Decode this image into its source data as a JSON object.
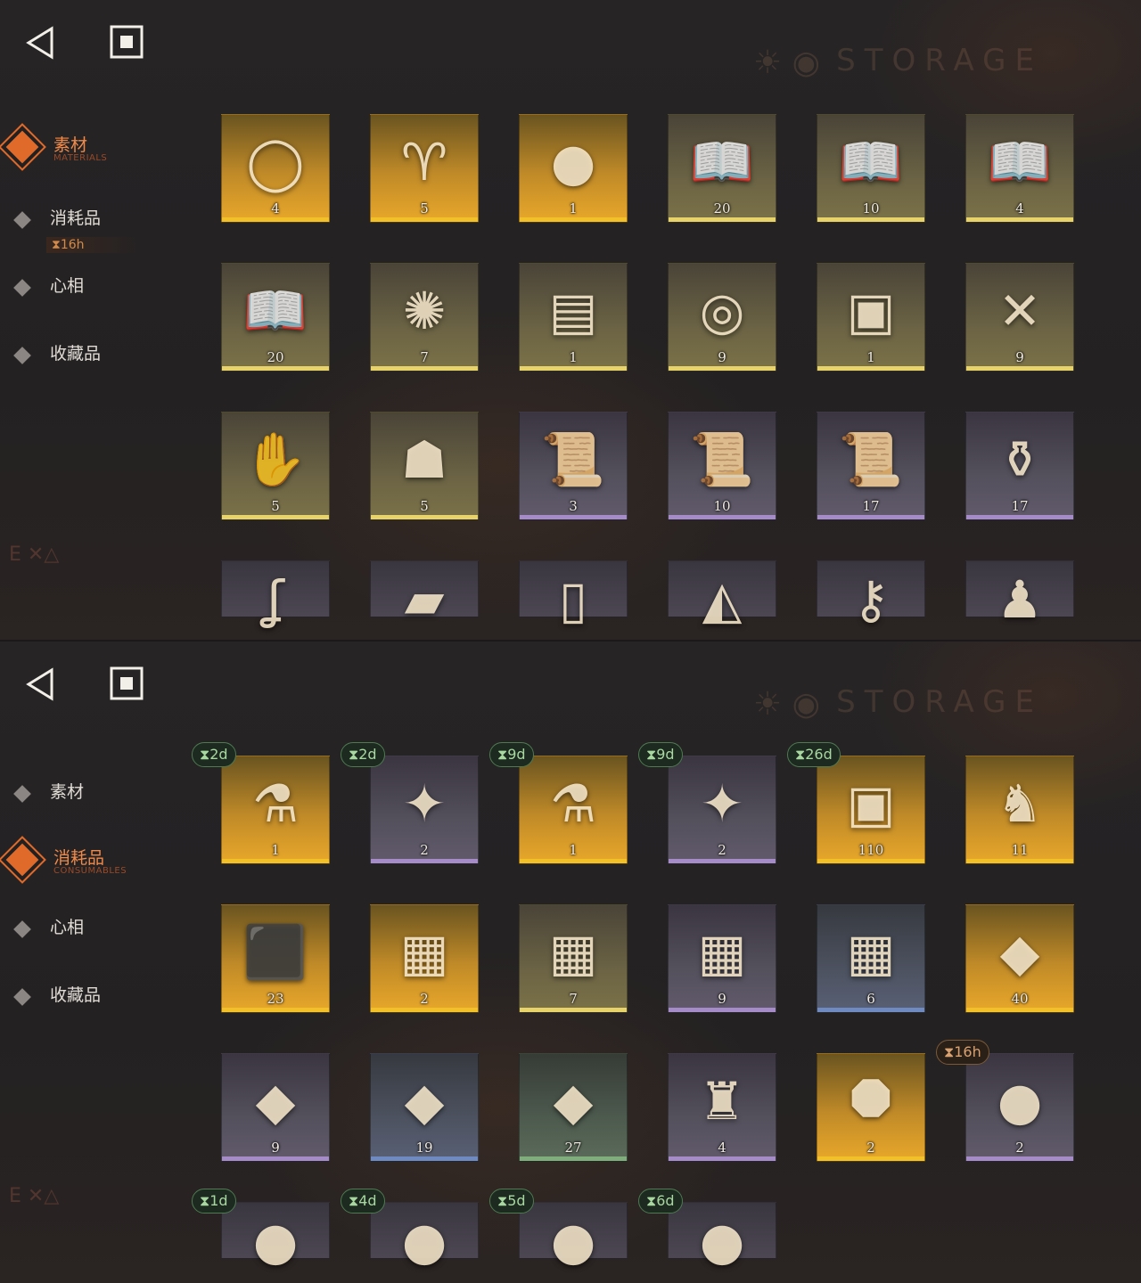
{
  "panels": [
    {
      "watermark": "STORAGE",
      "sidebar": {
        "items": [
          {
            "label": "素材",
            "sub": "MATERIALS",
            "active": true
          },
          {
            "label": "消耗品",
            "sub": "",
            "active": false
          },
          {
            "label": "心相",
            "sub": "",
            "active": false
          },
          {
            "label": "收藏品",
            "sub": "",
            "active": false
          }
        ],
        "timer": "⧗16h"
      },
      "items": [
        {
          "name": "ring",
          "icon": "◯",
          "count": "4",
          "rarity": "gold"
        },
        {
          "name": "yellow-ram",
          "icon": "♈",
          "count": "5",
          "rarity": "gold"
        },
        {
          "name": "apple-snake",
          "icon": "●",
          "count": "1",
          "rarity": "gold"
        },
        {
          "name": "book-red",
          "icon": "📖",
          "count": "20",
          "rarity": "olive"
        },
        {
          "name": "book-green",
          "icon": "📖",
          "count": "10",
          "rarity": "olive"
        },
        {
          "name": "book-blue",
          "icon": "📖",
          "count": "4",
          "rarity": "olive"
        },
        {
          "name": "book-gold",
          "icon": "📖",
          "count": "20",
          "rarity": "olive"
        },
        {
          "name": "astrolabe",
          "icon": "✺",
          "count": "7",
          "rarity": "olive"
        },
        {
          "name": "green-tablet",
          "icon": "▤",
          "count": "1",
          "rarity": "olive"
        },
        {
          "name": "metal-coin",
          "icon": "◎",
          "count": "9",
          "rarity": "olive"
        },
        {
          "name": "dark-book",
          "icon": "▣",
          "count": "1",
          "rarity": "olive"
        },
        {
          "name": "bullets",
          "icon": "✕",
          "count": "9",
          "rarity": "olive"
        },
        {
          "name": "hand-box",
          "icon": "✋",
          "count": "5",
          "rarity": "olive"
        },
        {
          "name": "ghost",
          "icon": "☗",
          "count": "5",
          "rarity": "olive"
        },
        {
          "name": "scroll-green",
          "icon": "📜",
          "count": "3",
          "rarity": "purple"
        },
        {
          "name": "scroll-blue",
          "icon": "📜",
          "count": "10",
          "rarity": "purple"
        },
        {
          "name": "scroll-gold",
          "icon": "📜",
          "count": "17",
          "rarity": "purple"
        },
        {
          "name": "amulet",
          "icon": "⚱",
          "count": "17",
          "rarity": "purple"
        },
        {
          "name": "hook",
          "icon": "ʆ",
          "count": "",
          "rarity": "plain"
        },
        {
          "name": "stone-tablet",
          "icon": "▰",
          "count": "",
          "rarity": "plain"
        },
        {
          "name": "frame",
          "icon": "▯",
          "count": "",
          "rarity": "plain"
        },
        {
          "name": "mask",
          "icon": "◭",
          "count": "",
          "rarity": "plain"
        },
        {
          "name": "dragonfly-key",
          "icon": "⚷",
          "count": "",
          "rarity": "plain"
        },
        {
          "name": "bird-figurine",
          "icon": "♟",
          "count": "",
          "rarity": "plain"
        }
      ]
    },
    {
      "watermark": "STORAGE",
      "sidebar": {
        "items": [
          {
            "label": "素材",
            "sub": "",
            "active": false
          },
          {
            "label": "消耗品",
            "sub": "CONSUMABLES",
            "active": true
          },
          {
            "label": "心相",
            "sub": "",
            "active": false
          },
          {
            "label": "收藏品",
            "sub": "",
            "active": false
          }
        ]
      },
      "items": [
        {
          "name": "candy-jar",
          "icon": "⚗",
          "count": "1",
          "rarity": "gold",
          "timer": "⧗2d",
          "timer_color": "green"
        },
        {
          "name": "lollipops",
          "icon": "✦",
          "count": "2",
          "rarity": "purple",
          "timer": "⧗2d",
          "timer_color": "green"
        },
        {
          "name": "candy-jar",
          "icon": "⚗",
          "count": "1",
          "rarity": "gold",
          "timer": "⧗9d",
          "timer_color": "green"
        },
        {
          "name": "lollipops",
          "icon": "✦",
          "count": "2",
          "rarity": "purple",
          "timer": "⧗9d",
          "timer_color": "green"
        },
        {
          "name": "red-book",
          "icon": "▣",
          "count": "110",
          "rarity": "gold",
          "timer": "⧗26d",
          "timer_color": "green"
        },
        {
          "name": "rabbit-box",
          "icon": "♞",
          "count": "11",
          "rarity": "gold",
          "timer": "",
          "timer_color": ""
        },
        {
          "name": "rune-box",
          "icon": "⬛",
          "count": "23",
          "rarity": "gold",
          "timer": "",
          "timer_color": ""
        },
        {
          "name": "crate-gold",
          "icon": "▦",
          "count": "2",
          "rarity": "gold",
          "timer": "",
          "timer_color": ""
        },
        {
          "name": "crate-olive",
          "icon": "▦",
          "count": "7",
          "rarity": "olive",
          "timer": "",
          "timer_color": ""
        },
        {
          "name": "crate-purple",
          "icon": "▦",
          "count": "9",
          "rarity": "purple",
          "timer": "",
          "timer_color": ""
        },
        {
          "name": "crate-blue",
          "icon": "▦",
          "count": "6",
          "rarity": "blue",
          "timer": "",
          "timer_color": ""
        },
        {
          "name": "parcel-gold",
          "icon": "◆",
          "count": "40",
          "rarity": "gold",
          "timer": "",
          "timer_color": ""
        },
        {
          "name": "parcel-purple",
          "icon": "◆",
          "count": "9",
          "rarity": "purple",
          "timer": "",
          "timer_color": ""
        },
        {
          "name": "parcel-blue",
          "icon": "◆",
          "count": "19",
          "rarity": "blue",
          "timer": "",
          "timer_color": ""
        },
        {
          "name": "parcel-green",
          "icon": "◆",
          "count": "27",
          "rarity": "green",
          "timer": "",
          "timer_color": ""
        },
        {
          "name": "castle",
          "icon": "♜",
          "count": "4",
          "rarity": "purple",
          "timer": "",
          "timer_color": ""
        },
        {
          "name": "puzzle-octagon",
          "icon": "⯃",
          "count": "2",
          "rarity": "gold",
          "timer": "",
          "timer_color": ""
        },
        {
          "name": "candies",
          "icon": "●",
          "count": "2",
          "rarity": "purple",
          "timer": "⧗16h",
          "timer_color": "orange"
        },
        {
          "name": "candies",
          "icon": "●",
          "count": "",
          "rarity": "plain",
          "timer": "⧗1d",
          "timer_color": "green"
        },
        {
          "name": "candies",
          "icon": "●",
          "count": "",
          "rarity": "plain",
          "timer": "⧗4d",
          "timer_color": "green"
        },
        {
          "name": "candies",
          "icon": "●",
          "count": "",
          "rarity": "plain",
          "timer": "⧗5d",
          "timer_color": "green"
        },
        {
          "name": "candies",
          "icon": "●",
          "count": "",
          "rarity": "plain",
          "timer": "⧗6d",
          "timer_color": "green"
        }
      ]
    }
  ]
}
